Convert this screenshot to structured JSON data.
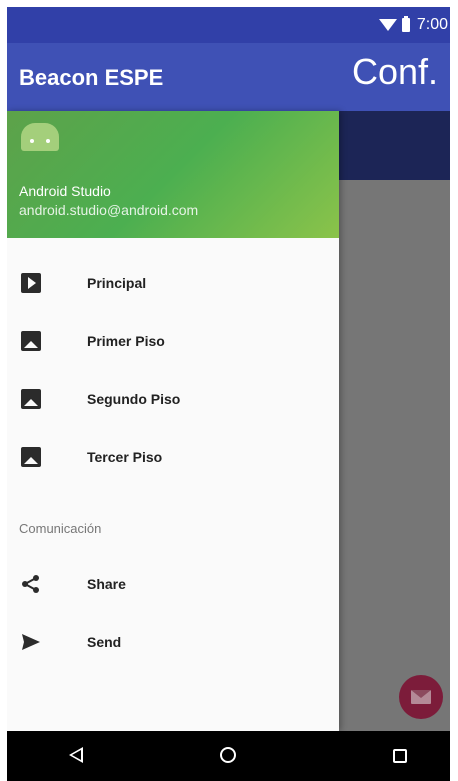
{
  "status_bar": {
    "time": "7:00"
  },
  "app_bar": {
    "title": "Beacon ESPE",
    "action": "Conf."
  },
  "drawer": {
    "header": {
      "name": "Android Studio",
      "email": "android.studio@android.com"
    },
    "items": [
      {
        "label": "Principal",
        "icon": "play-box-icon"
      },
      {
        "label": "Primer Piso",
        "icon": "photo-icon"
      },
      {
        "label": "Segundo Piso",
        "icon": "photo-icon"
      },
      {
        "label": "Tercer Piso",
        "icon": "photo-icon"
      }
    ],
    "section_label": "Comunicación",
    "section_items": [
      {
        "label": "Share",
        "icon": "share-icon"
      },
      {
        "label": "Send",
        "icon": "send-icon"
      }
    ]
  },
  "colors": {
    "primary": "#3f51b5",
    "primary_dark": "#3140a8",
    "header_green": "#4caf50",
    "fab": "#7c1c3a"
  }
}
